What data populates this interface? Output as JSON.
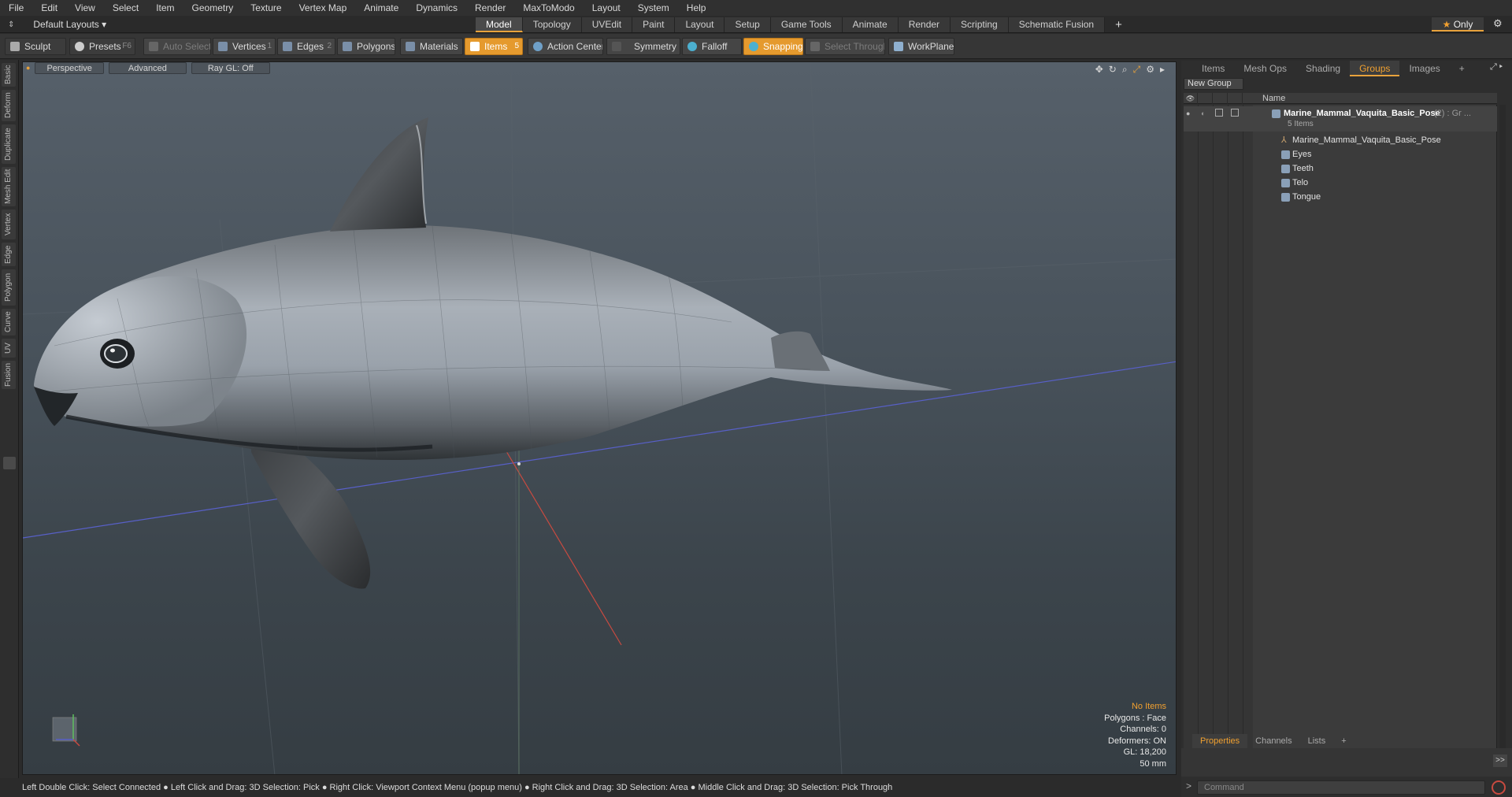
{
  "menu": [
    "File",
    "Edit",
    "View",
    "Select",
    "Item",
    "Geometry",
    "Texture",
    "Vertex Map",
    "Animate",
    "Dynamics",
    "Render",
    "MaxToModo",
    "Layout",
    "System",
    "Help"
  ],
  "layout": {
    "selector": "Default Layouts ▾",
    "tabs": [
      "Model",
      "Topology",
      "UVEdit",
      "Paint",
      "Layout",
      "Setup",
      "Game Tools",
      "Animate",
      "Render",
      "Scripting",
      "Schematic Fusion"
    ],
    "active": "Model",
    "only": "Only"
  },
  "toolbar": {
    "sculpt": "Sculpt",
    "presets": "Presets",
    "presets_key": "F6",
    "auto_select": "Auto Select",
    "vertices": "Vertices",
    "vertices_key": "1",
    "edges": "Edges",
    "edges_key": "2",
    "polygons": "Polygons",
    "materials": "Materials",
    "items": "Items",
    "items_key": "5",
    "action_center": "Action Center",
    "symmetry": "Symmetry",
    "falloff": "Falloff",
    "snapping": "Snapping",
    "select_through": "Select Through",
    "workplane": "WorkPlane"
  },
  "left_tabs": [
    "Basic",
    "Deform",
    "Duplicate",
    "Mesh Edit",
    "Vertex",
    "Edge",
    "Polygon",
    "Curve",
    "UV",
    "Fusion"
  ],
  "viewport": {
    "perspective": "Perspective",
    "advanced": "Advanced",
    "raygl": "Ray GL: Off",
    "info": {
      "no_items": "No Items",
      "polygons": "Polygons : Face",
      "channels": "Channels: 0",
      "deformers": "Deformers: ON",
      "gl": "GL: 18,200",
      "focal": "50 mm"
    }
  },
  "status": "Left Double Click: Select Connected ● Left Click and Drag: 3D Selection: Pick ● Right Click: Viewport Context Menu (popup menu) ● Right Click and Drag: 3D Selection: Area ● Middle Click and Drag: 3D Selection: Pick Through",
  "right_panel": {
    "tabs": [
      "Items",
      "Mesh Ops",
      "Shading",
      "Groups",
      "Images"
    ],
    "active": "Groups",
    "new_group": "New Group",
    "col_name": "Name",
    "group": {
      "name": "Marine_Mammal_Vaquita_Basic_Pose",
      "suffix": "(2) : Gr ...",
      "count": "5 Items"
    },
    "children": [
      "Marine_Mammal_Vaquita_Basic_Pose",
      "Eyes",
      "Teeth",
      "Telo",
      "Tongue"
    ],
    "bottom_tabs": [
      "Properties",
      "Channels",
      "Lists"
    ],
    "bottom_active": "Properties",
    "command_placeholder": "Command"
  },
  "colors": {
    "accent": "#e8a23c",
    "tree_icon": "#8aa0b8"
  }
}
